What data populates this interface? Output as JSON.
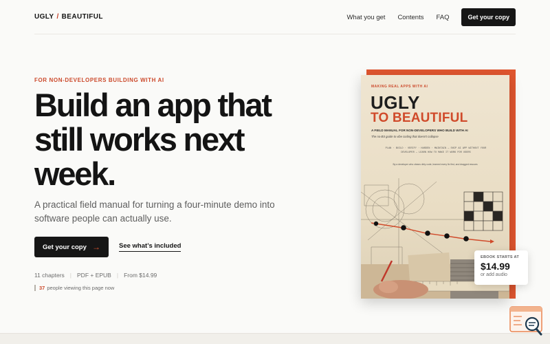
{
  "header": {
    "logo_left": "UGLY",
    "logo_sep": "/",
    "logo_right": "BEAUTIFUL",
    "nav": [
      "What you get",
      "Contents",
      "FAQ"
    ],
    "cta": "Get your copy"
  },
  "hero": {
    "eyebrow": "FOR NON-DEVELOPERS BUILDING WITH AI",
    "headline": "Build an app that still works next week.",
    "subtitle": "A practical field manual for turning a four-minute demo into software people can actually use.",
    "primary_button": "Get your copy",
    "secondary_link": "See what’s included",
    "meta": [
      "11 chapters",
      "PDF + EPUB",
      "From $14.99"
    ],
    "viewers_count": "37",
    "viewers_text": "people viewing this page now"
  },
  "book": {
    "eyebrow": "MAKING REAL APPS WITH AI",
    "title_line1": "UGLY",
    "title_line2": "TO BEAUTIFUL",
    "tagline": "A FIELD MANUAL FOR NON-DEVELOPERS WHO BUILD WITH AI",
    "subtagline": "The no-BS guide to vibe coding that doesn't collapse",
    "mono_text": "PLAN · BUILD · VERIFY · HARDEN · MAINTAIN — SHIP AI APP WITHOUT YOUR DEVELOPER — LEARN HOW TO MAKE IT WORK FOR USERS",
    "small_text": "By a developer who cleans dirty code, learned every fix first, and dragged rescues"
  },
  "price_card": {
    "label": "EBOOK STARTS AT",
    "amount": "$14.99",
    "audio": "or add audio"
  },
  "colors": {
    "accent": "#e0562f",
    "dark": "#161616",
    "background": "#fafaf8"
  },
  "icons": {
    "cta_arrow": "arrow-right-icon",
    "widget": "search-chat-icon"
  }
}
